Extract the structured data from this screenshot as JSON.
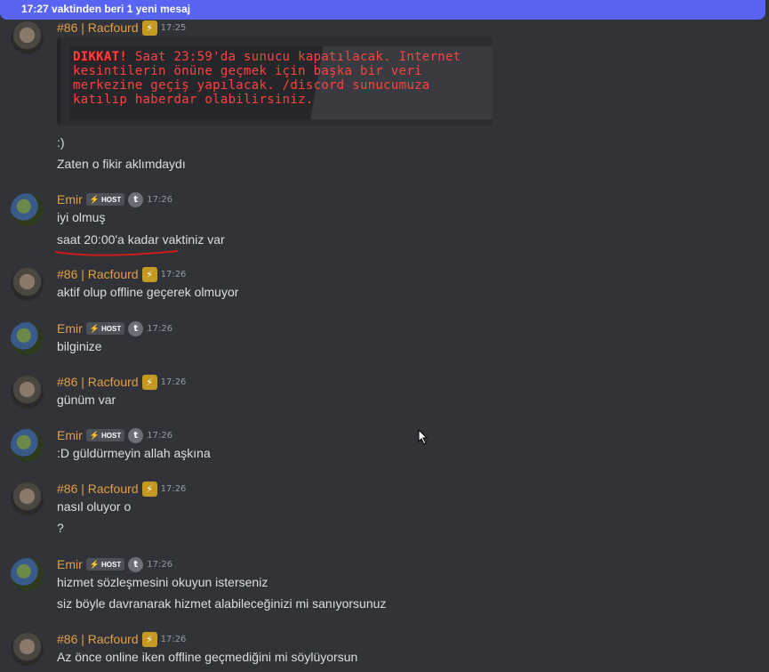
{
  "banner": {
    "text": "17:27 vaktinden beri 1 yeni mesaj"
  },
  "users": {
    "racfourd": {
      "name": "#86 | Racfourd",
      "badge": "⚡"
    },
    "emir": {
      "name": "Emir",
      "host_label": "HOST",
      "host_bolt": "⚡",
      "t_badge": "t"
    }
  },
  "colors": {
    "name": "#e0a04a",
    "accent": "#5865f2",
    "warning": "#ff4040",
    "underline": "#d11a1a"
  },
  "messages": [
    {
      "user": "racfourd",
      "time": "17:25",
      "embed": {
        "warn": "DIKKAT!",
        "text": " Saat 23:59'da sunucu kapatılacak. Internet kesintilerin önüne geçmek için başka bir veri merkezine geçiş yapılacak. /discord sunucumuza katılıp haberdar olabilirsiniz."
      },
      "lines": [
        ":)",
        "Zaten o fikir aklımdaydı"
      ]
    },
    {
      "user": "emir",
      "time": "17:26",
      "lines": [
        "iyi olmuş",
        "saat 20:00'a kadar vaktiniz var"
      ]
    },
    {
      "user": "racfourd",
      "time": "17:26",
      "lines": [
        "aktif olup offline geçerek olmuyor"
      ]
    },
    {
      "user": "emir",
      "time": "17:26",
      "lines": [
        "bilginize"
      ]
    },
    {
      "user": "racfourd",
      "time": "17:26",
      "lines": [
        "günüm var"
      ]
    },
    {
      "user": "emir",
      "time": "17:26",
      "lines": [
        ":D güldürmeyin allah aşkına"
      ]
    },
    {
      "user": "racfourd",
      "time": "17:26",
      "lines": [
        "nasıl oluyor o",
        "?"
      ]
    },
    {
      "user": "emir",
      "time": "17:26",
      "lines": [
        "hizmet sözleşmesini okuyun isterseniz",
        "siz böyle davranarak hizmet alabileceğinizi mi sanıyorsunuz"
      ]
    },
    {
      "user": "racfourd",
      "time": "17:26",
      "lines": [
        "Az önce online iken offline geçmediğini mi söylüyorsun"
      ]
    }
  ]
}
